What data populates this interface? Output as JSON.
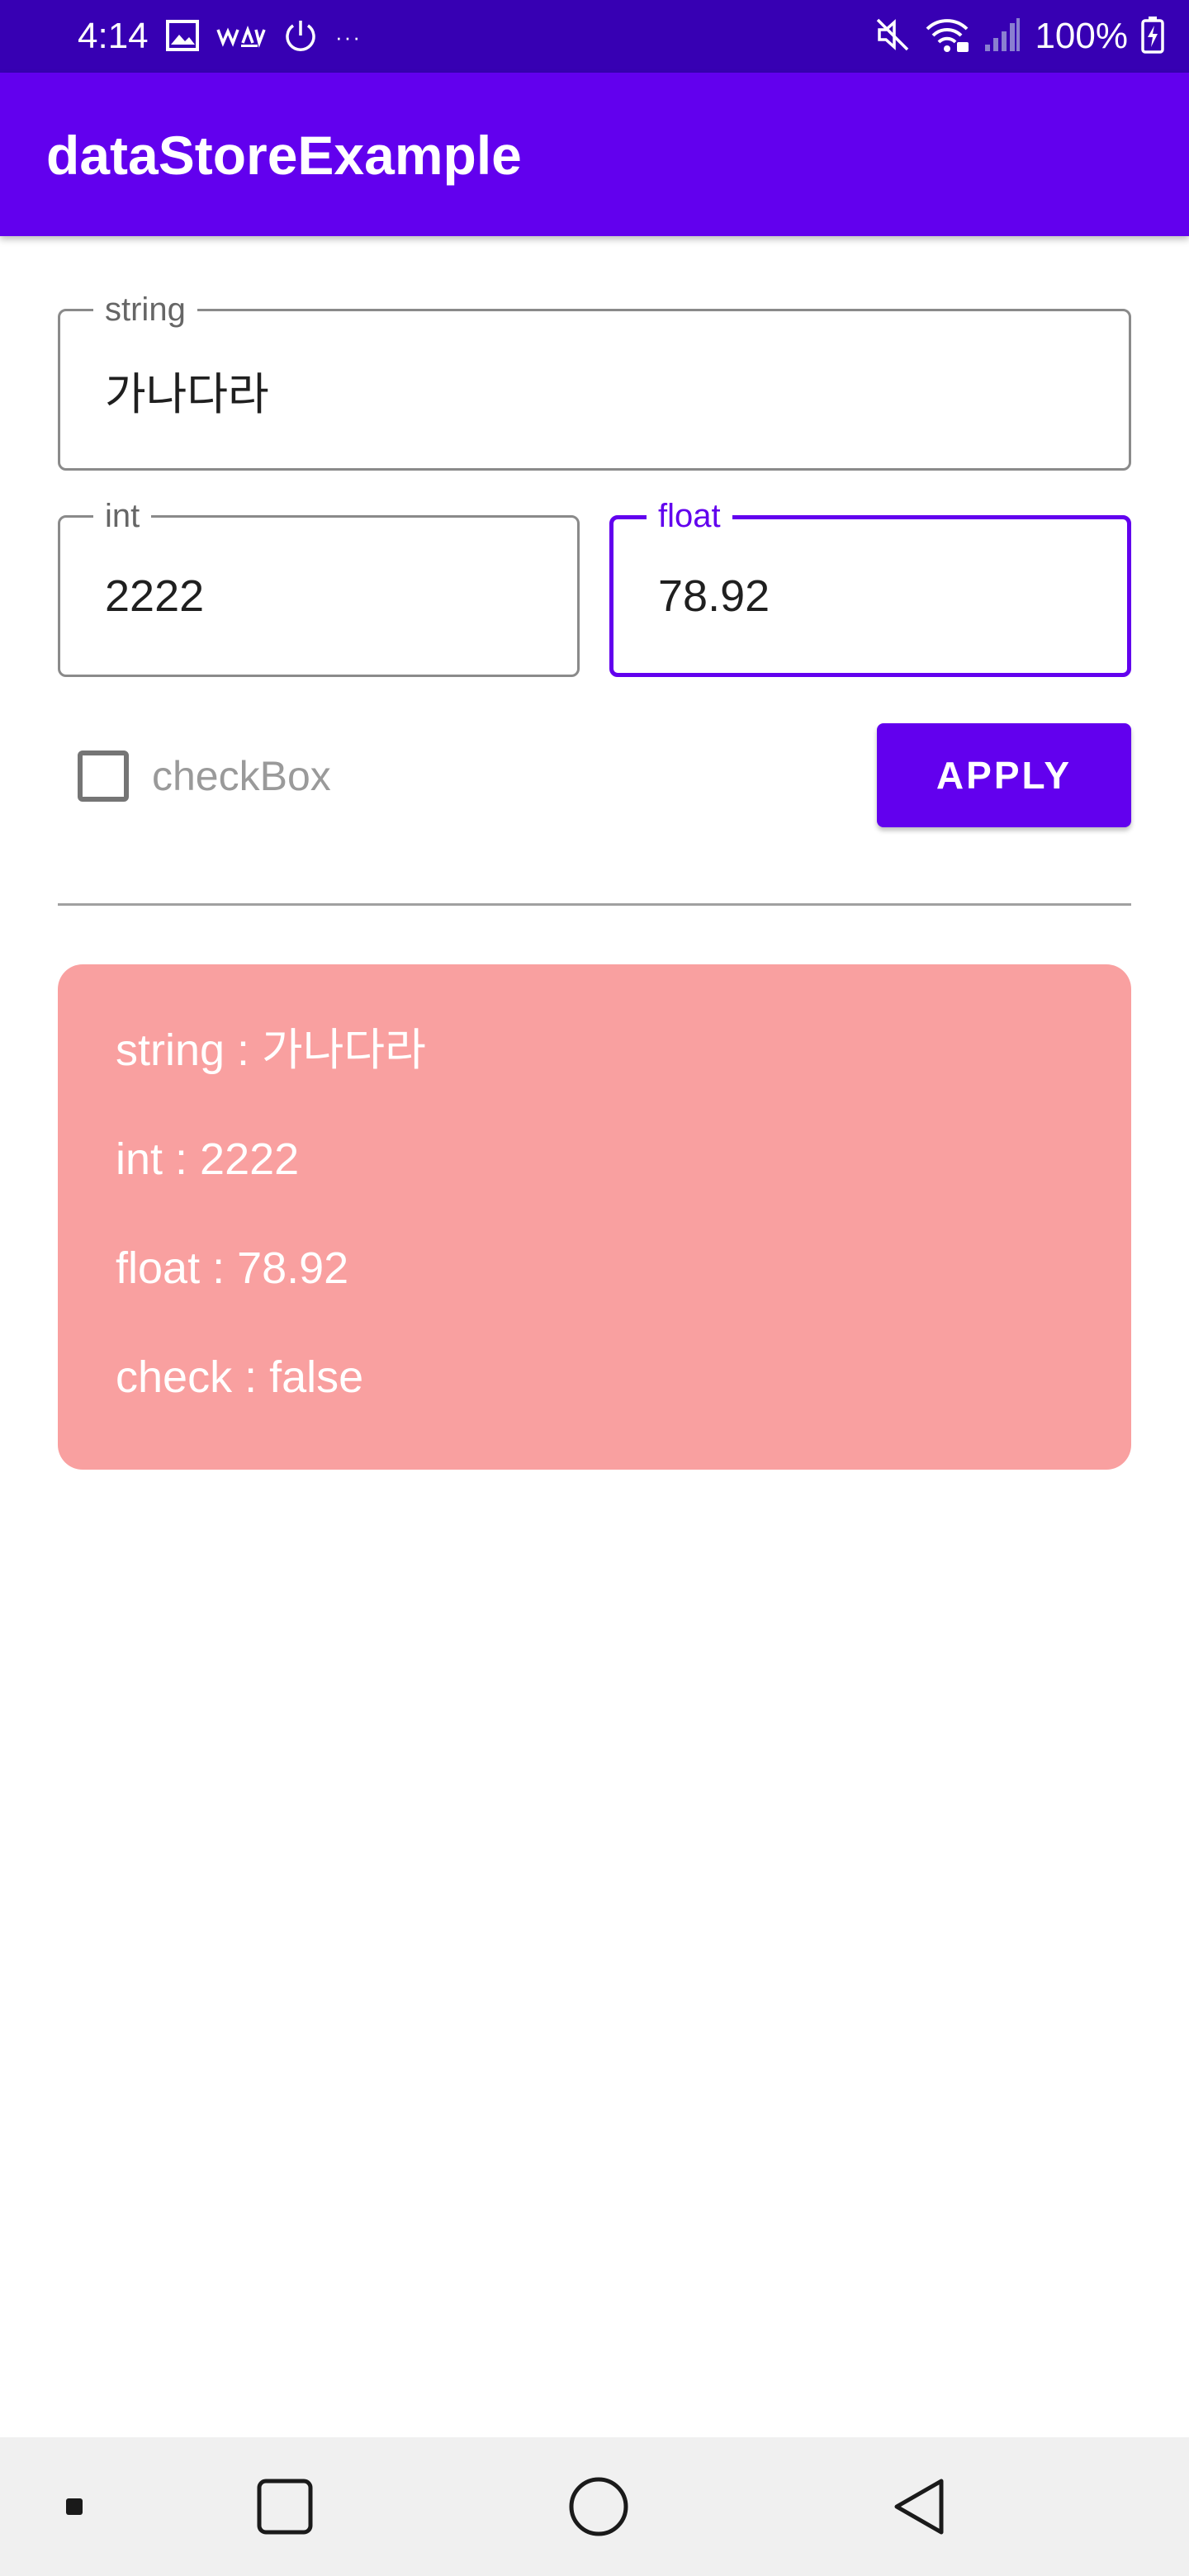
{
  "status_bar": {
    "time": "4:14",
    "battery": "100%",
    "overflow_dots": "···",
    "left_icons": [
      "image-icon",
      "wavve-icon",
      "power-icon",
      "more-dots-icon"
    ],
    "right_icons": [
      "mute-icon",
      "wifi-icon",
      "signal-icon",
      "battery-charging-icon"
    ]
  },
  "app_bar": {
    "title": "dataStoreExample"
  },
  "form": {
    "string_field": {
      "label": "string",
      "value": "가나다라"
    },
    "int_field": {
      "label": "int",
      "value": "2222"
    },
    "float_field": {
      "label": "float",
      "value": "78.92"
    },
    "checkbox": {
      "label": "checkBox",
      "checked": false
    },
    "apply_label": "APPLY"
  },
  "result": {
    "lines": [
      "string : 가나다라",
      "int : 2222",
      "float : 78.92",
      "check : false"
    ]
  },
  "nav_bar": {
    "buttons": [
      "recent-apps-button",
      "home-button",
      "back-button"
    ]
  },
  "colors": {
    "primary": "#6200ee",
    "primary_dark": "#3700b3",
    "result_background": "#f9a0a0"
  }
}
